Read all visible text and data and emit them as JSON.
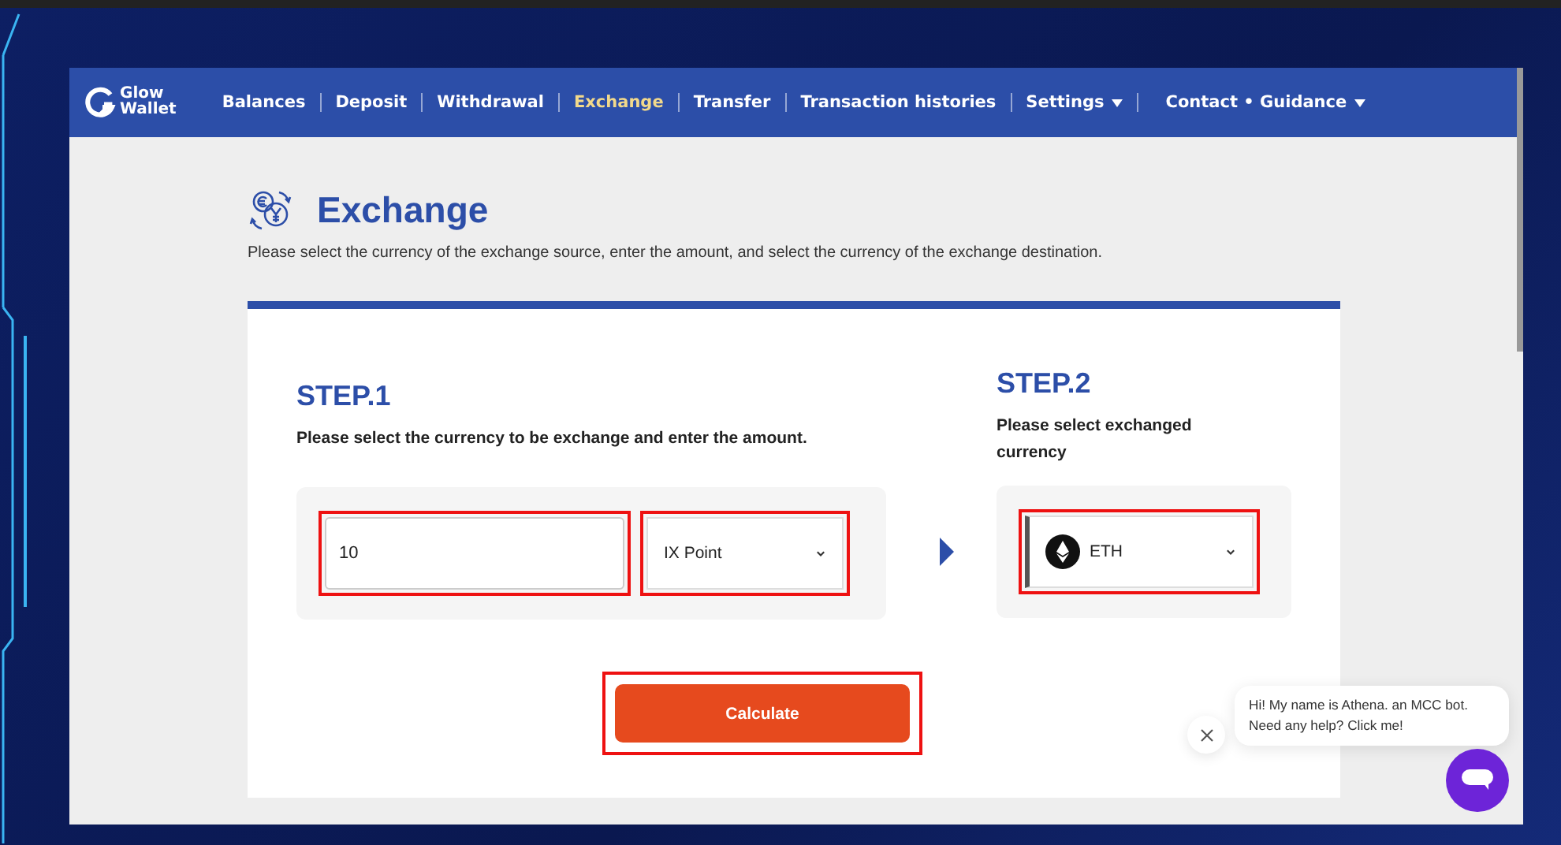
{
  "brand": {
    "line1": "Glow",
    "line2": "Wallet"
  },
  "nav": [
    {
      "label": "Balances",
      "selected": false,
      "kind": "link"
    },
    {
      "label": "Deposit",
      "selected": false,
      "kind": "link"
    },
    {
      "label": "Withdrawal",
      "selected": false,
      "kind": "link"
    },
    {
      "label": "Exchange",
      "selected": true,
      "kind": "link"
    },
    {
      "label": "Transfer",
      "selected": false,
      "kind": "link"
    },
    {
      "label": "Transaction histories",
      "selected": false,
      "kind": "link"
    },
    {
      "label": "Settings",
      "selected": false,
      "kind": "dropdown"
    },
    {
      "label": "Contact • Guidance",
      "selected": false,
      "kind": "dropdown"
    }
  ],
  "page": {
    "title": "Exchange",
    "description": "Please select the currency of the exchange source, enter the amount, and select the currency of the exchange destination."
  },
  "step1": {
    "title": "STEP.1",
    "instruction": "Please select the currency to be exchange and enter the amount.",
    "amount": {
      "value": "10",
      "highlighted": true
    },
    "currency": {
      "value": "IX Point",
      "highlighted": true
    }
  },
  "step2": {
    "title": "STEP.2",
    "instruction": "Please select exchanged currency",
    "currency": {
      "value": "ETH",
      "highlighted": true
    }
  },
  "calculate": {
    "label": "Calculate",
    "highlighted": true
  },
  "chat": {
    "message": "Hi! My name is Athena. an MCC bot. Need any help? Click me!"
  }
}
